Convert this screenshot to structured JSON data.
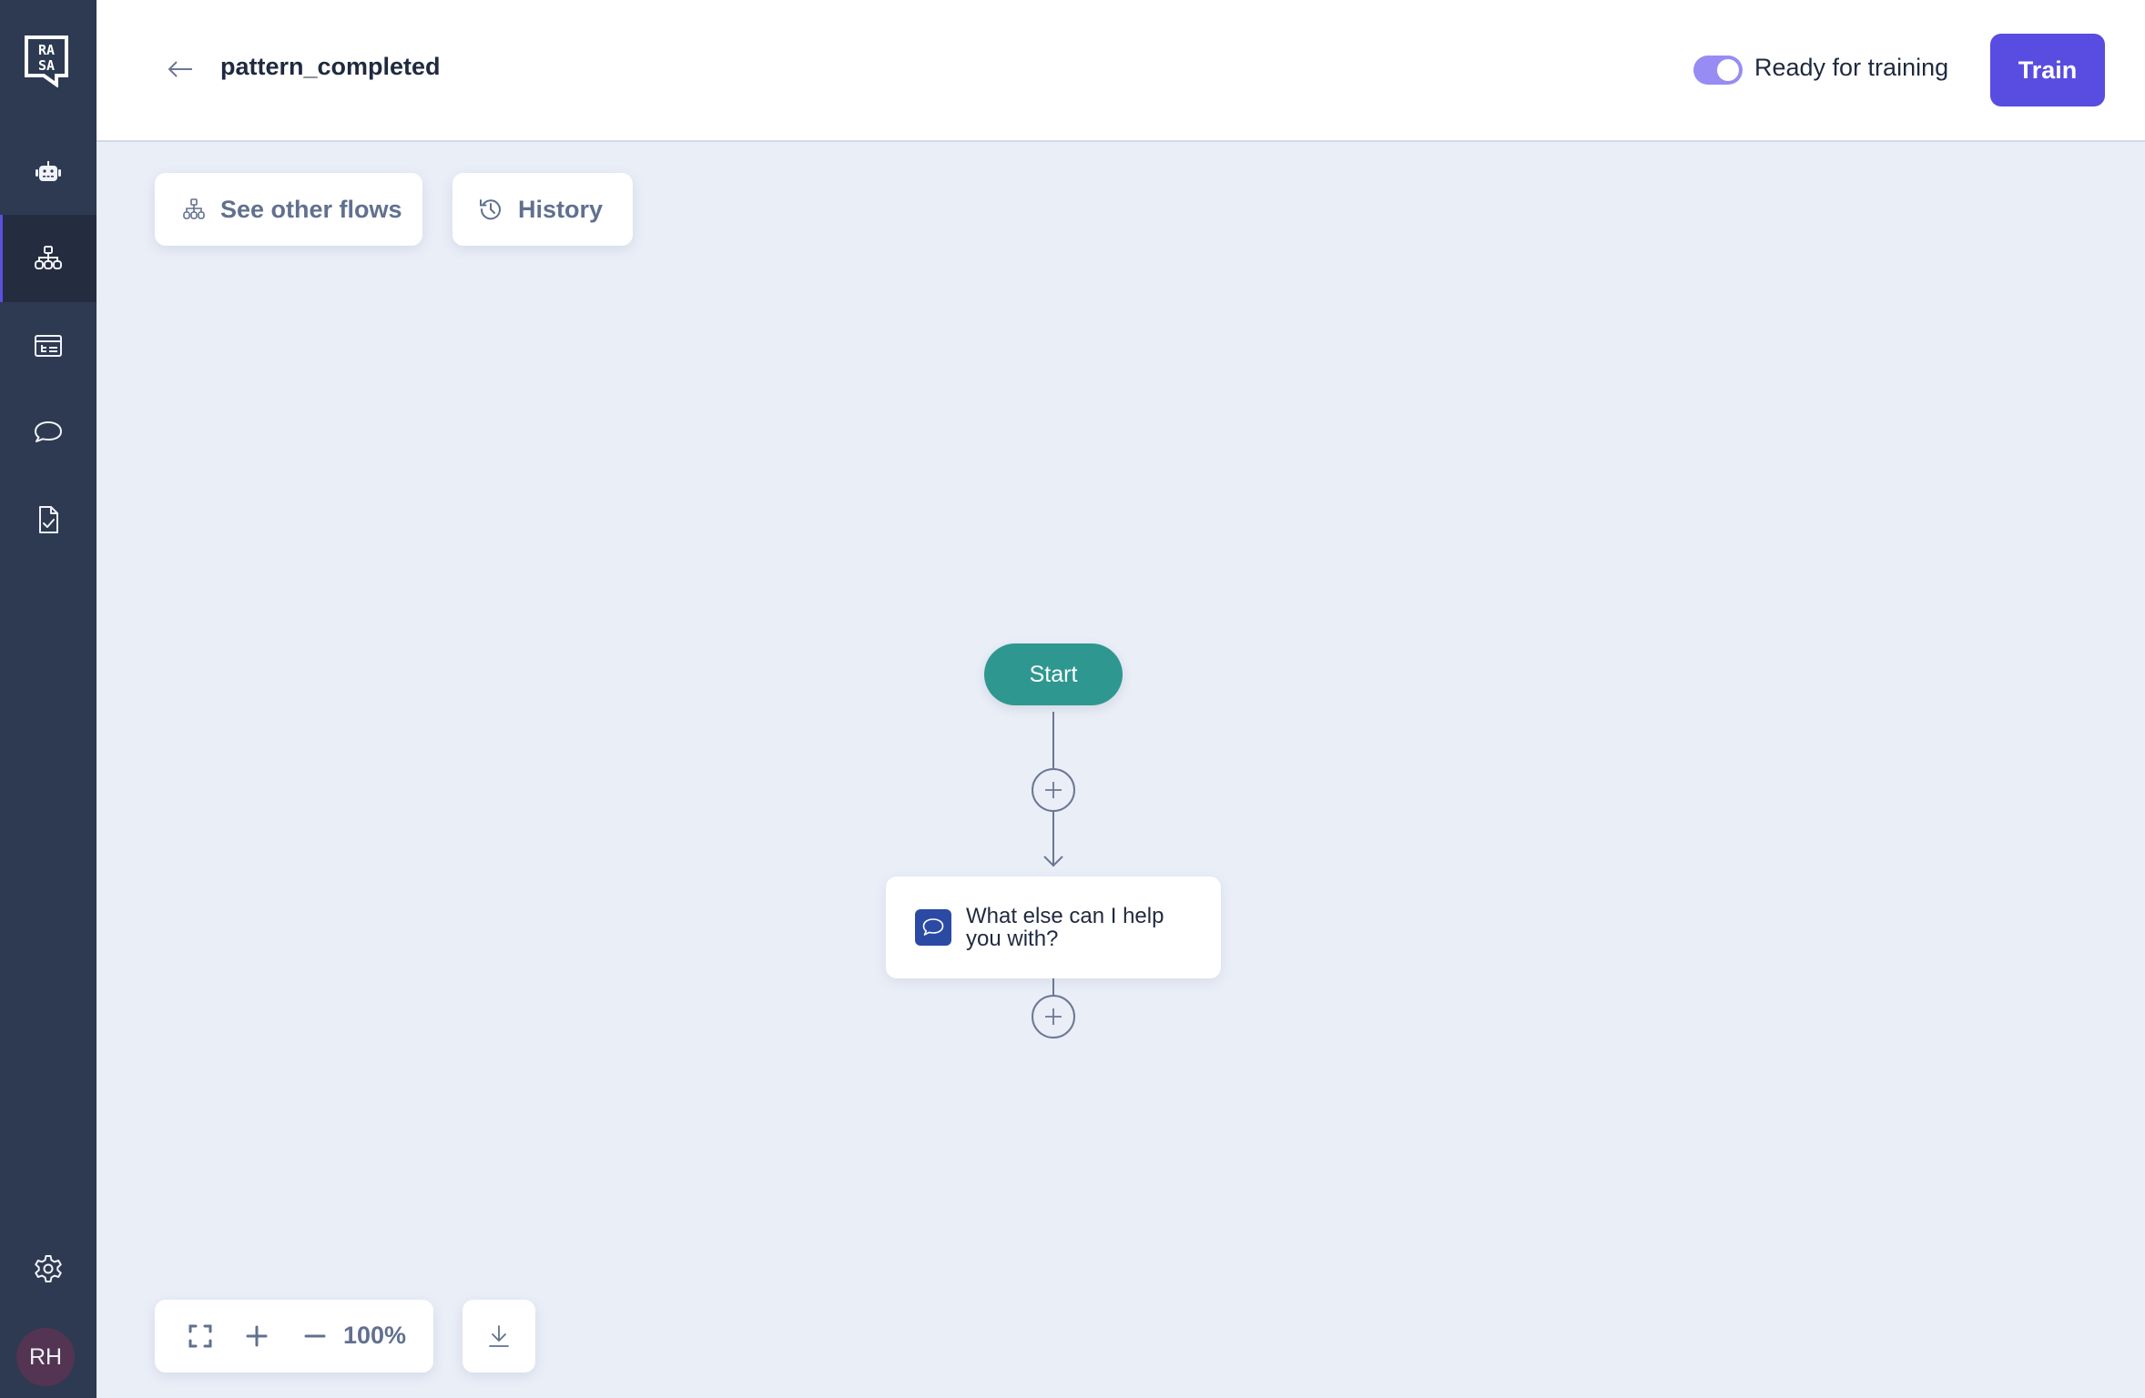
{
  "sidebar": {
    "logo": "rasa-logo",
    "items": [
      {
        "name": "assistant",
        "icon": "robot-icon",
        "active": false
      },
      {
        "name": "flows",
        "icon": "flows-icon",
        "active": true
      },
      {
        "name": "responses",
        "icon": "table-list-icon",
        "active": false
      },
      {
        "name": "conversations",
        "icon": "chat-bubble-icon",
        "active": false
      },
      {
        "name": "tests",
        "icon": "file-check-icon",
        "active": false
      }
    ],
    "settings_icon": "gear-icon",
    "avatar_initials": "RH"
  },
  "header": {
    "back_icon": "arrow-left-icon",
    "title": "pattern_completed",
    "toggle_label": "Ready for training",
    "toggle_on": true,
    "train_label": "Train"
  },
  "canvas": {
    "see_other_flows_label": "See other flows",
    "history_label": "History",
    "nodes": [
      {
        "type": "start",
        "label": "Start"
      },
      {
        "type": "message",
        "label": "What else can I help you with?"
      }
    ],
    "zoom_level": "100%"
  },
  "colors": {
    "accent": "#584de0",
    "sidebar_bg": "#2d3a52",
    "start_node": "#2e9890",
    "message_icon": "#2b4aa3",
    "canvas_bg": "#eaeef7"
  }
}
